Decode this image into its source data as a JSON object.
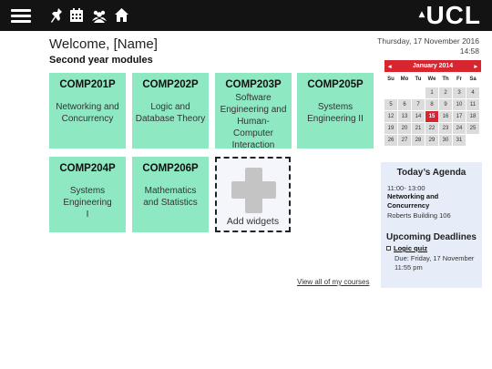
{
  "header": {
    "logo_text": "UCL",
    "icons": [
      "menu-icon",
      "pin-icon",
      "calendar-icon",
      "people-icon",
      "home-icon"
    ]
  },
  "welcome": "Welcome, [Name]",
  "section_title": "Second year modules",
  "modules": [
    {
      "code": "COMP201P",
      "name": "Networking and Concurrency"
    },
    {
      "code": "COMP202P",
      "name": "Logic and Database Theory"
    },
    {
      "code": "COMP203P",
      "name": "Software Engineering and Human-Computer Interaction"
    },
    {
      "code": "COMP205P",
      "name": "Systems Engineering II"
    },
    {
      "code": "COMP204P",
      "name": "Systems Engineering I"
    },
    {
      "code": "COMP206P",
      "name": "Mathematics and Statistics"
    }
  ],
  "add_widget_label": "Add widgets",
  "view_all_link": "View all of my courses",
  "datetime": {
    "date": "Thursday, 17 November 2016",
    "time": "14:58"
  },
  "calendar": {
    "month": "January 2014",
    "prev": "◂",
    "next": "▸",
    "days_of_week": [
      "Su",
      "Mo",
      "Tu",
      "We",
      "Th",
      "Fr",
      "Sa"
    ],
    "leading_blanks": 3,
    "days_in_month": 31,
    "today": 15
  },
  "agenda": {
    "title": "Today’s Agenda",
    "time": "11:00- 13:00",
    "course": "Networking and Concurrency",
    "location": "Roberts Building 106"
  },
  "deadlines": {
    "title": "Upcoming Deadlines",
    "item": "Logic quiz",
    "due": "Due: Friday, 17 November 11:55 pm"
  },
  "colors": {
    "tile": "#8ee8c2",
    "topbar": "#131313",
    "accent_red": "#d72630",
    "agenda_bg": "#e6edf8"
  }
}
